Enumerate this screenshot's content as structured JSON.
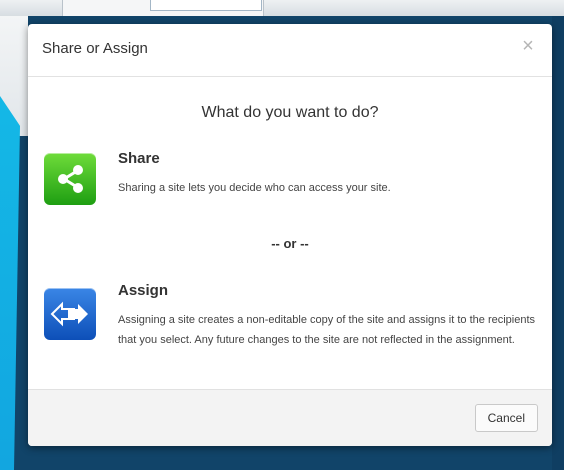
{
  "dialog": {
    "title": "Share or Assign",
    "close_label": "×",
    "question": "What do you want to do?",
    "or_text": "-- or --",
    "cancel_label": "Cancel",
    "options": [
      {
        "title": "Share",
        "description": "Sharing a site lets you decide who can access your site.",
        "icon": "share-icon",
        "color": "#2aa51a"
      },
      {
        "title": "Assign",
        "description": "Assigning a site creates a non-editable copy of the site and assigns it to the recipients that you select. Any future changes to the site are not reflected in the assignment.",
        "icon": "swap-arrows-icon",
        "color": "#1557c0"
      }
    ]
  }
}
